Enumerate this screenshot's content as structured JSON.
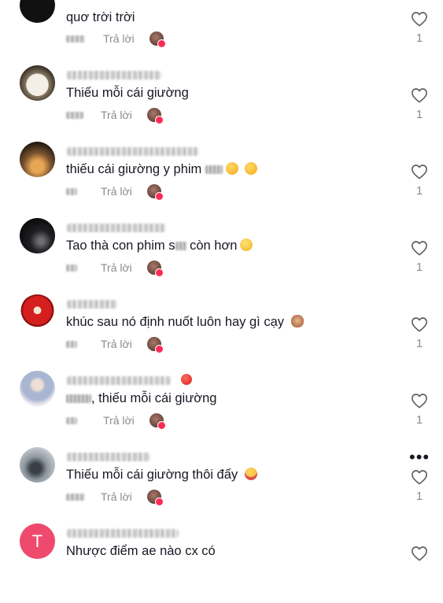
{
  "reply_label": "Trả lời",
  "comments": [
    {
      "avatar": "avatar-dark",
      "text_parts": [
        "quơ trời trời"
      ],
      "likes": "1",
      "colors": [
        "#111111",
        "#111111"
      ]
    },
    {
      "avatar": "avatar-dog",
      "text_parts": [
        "Thiếu mỗi cái giường"
      ],
      "likes": "1",
      "colors": [
        "#f2efe8",
        "#5a4a3a"
      ]
    },
    {
      "avatar": "avatar-lights",
      "text_parts": [
        "thiếu cái giường y phim ",
        ""
      ],
      "likes": "1",
      "colors": [
        "#2e2416",
        "#d89a4c"
      ]
    },
    {
      "avatar": "avatar-night",
      "text_parts": [
        "Tao thà con phim s",
        " còn hơn"
      ],
      "likes": "1",
      "colors": [
        "#0c0c0f",
        "#5b5b60"
      ]
    },
    {
      "avatar": "avatar-ranger",
      "text_parts": [
        "khúc sau nó định nuốt luôn hay gì cạy "
      ],
      "likes": "1",
      "colors": [
        "#d01e1e",
        "#f1c232"
      ]
    },
    {
      "avatar": "avatar-girl",
      "text_parts": [
        "",
        ", thiếu mỗi cái giường"
      ],
      "likes": "1",
      "colors": [
        "#e9e4ea",
        "#9aa9c8"
      ]
    },
    {
      "avatar": "avatar-bike",
      "text_parts": [
        "Thiếu mỗi cái giường thôi đấy "
      ],
      "likes": "1",
      "colors": [
        "#8c949c",
        "#2f3338"
      ]
    },
    {
      "avatar": "avatar-letter",
      "avatar_letter": "T",
      "text_parts": [
        "Nhược điểm ae nào cx có"
      ],
      "likes": "",
      "colors": [
        "#ee4a6e",
        "#ee4a6e"
      ]
    }
  ],
  "icons": {
    "like": "heart-outline-icon",
    "more": "more-dots-icon",
    "reply_avatar": "creator-avatar-heart-icon"
  },
  "accent": "#fe2c55",
  "more_label": "•••"
}
